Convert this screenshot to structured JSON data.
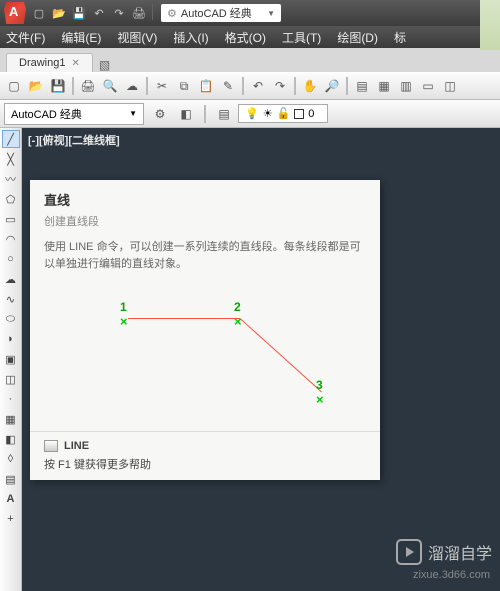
{
  "titlebar": {
    "search_label": "AutoCAD 经典"
  },
  "menubar": {
    "file": "文件(F)",
    "edit": "编辑(E)",
    "view": "视图(V)",
    "insert": "插入(I)",
    "format": "格式(O)",
    "tools": "工具(T)",
    "draw": "绘图(D)",
    "annotate": "标"
  },
  "tabs": {
    "current": "Drawing1"
  },
  "workspace": {
    "label": "AutoCAD 经典"
  },
  "layer": {
    "current": "0"
  },
  "viewport": {
    "label": "[-][俯视][二维线框]"
  },
  "tooltip": {
    "title": "直线",
    "subtitle": "创建直线段",
    "desc": "使用 LINE 命令，可以创建一系列连续的直线段。每条线段都是可以单独进行编辑的直线对象。",
    "points": {
      "p1": "1",
      "p2": "2",
      "p3": "3"
    },
    "cmd": "LINE",
    "help": "按 F1 键获得更多帮助"
  },
  "watermark": {
    "brand": "溜溜自学",
    "url": "zixue.3d66.com"
  }
}
